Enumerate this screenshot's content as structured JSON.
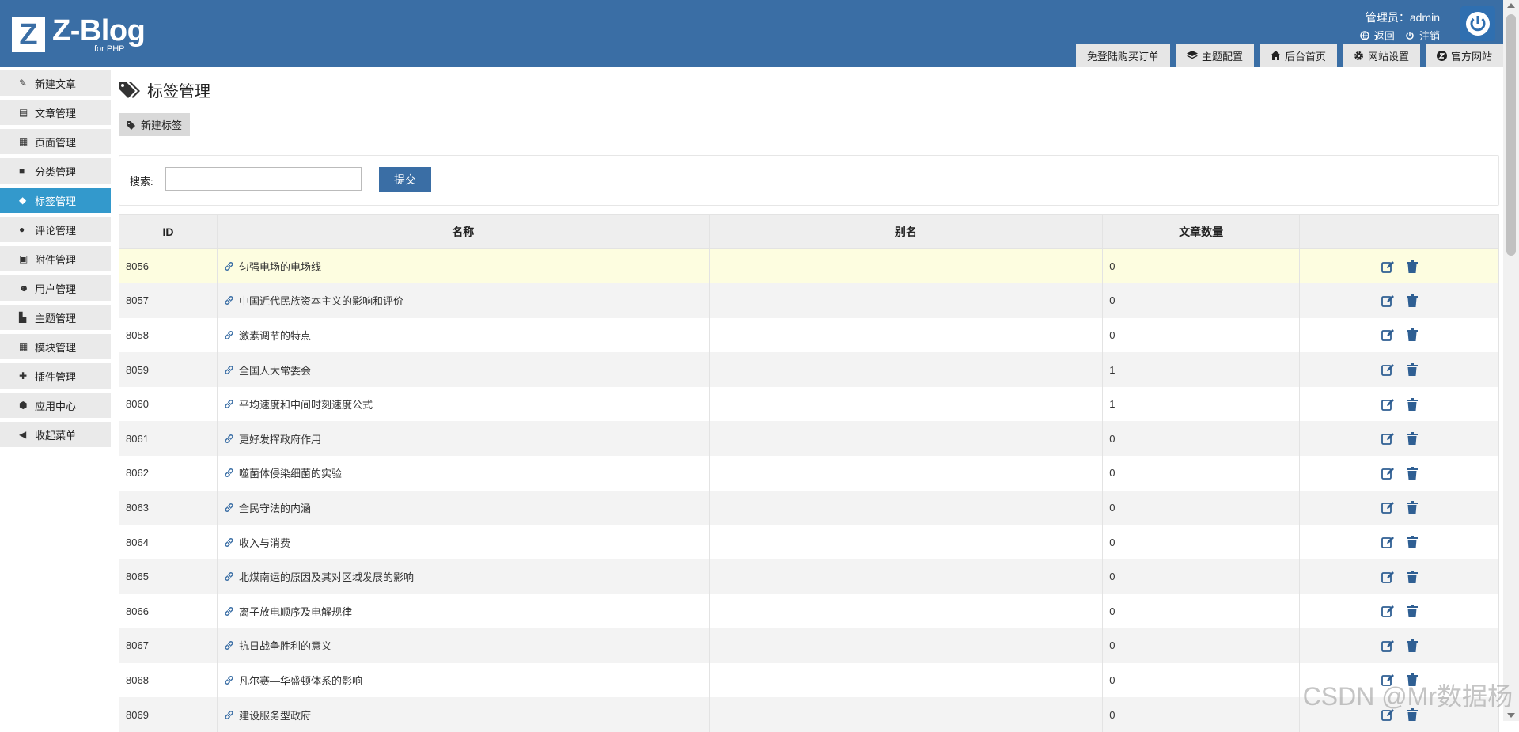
{
  "header": {
    "logo_main": "Z-Blog",
    "logo_sub": "for PHP",
    "user_label": "管理员：admin",
    "back_label": "返回",
    "logout_label": "注销",
    "tabs": [
      {
        "label": "免登陆购买订单",
        "icon": ""
      },
      {
        "label": "主题配置",
        "icon": "layers-icon"
      },
      {
        "label": "后台首页",
        "icon": "home-icon"
      },
      {
        "label": "网站设置",
        "icon": "gear-icon"
      },
      {
        "label": "官方网站",
        "icon": "zblog-icon"
      }
    ]
  },
  "sidebar": {
    "items": [
      {
        "label": "新建文章",
        "icon": "edit-icon"
      },
      {
        "label": "文章管理",
        "icon": "document-icon"
      },
      {
        "label": "页面管理",
        "icon": "page-icon"
      },
      {
        "label": "分类管理",
        "icon": "folder-icon"
      },
      {
        "label": "标签管理",
        "icon": "tag-icon",
        "active": true
      },
      {
        "label": "评论管理",
        "icon": "comment-icon"
      },
      {
        "label": "附件管理",
        "icon": "archive-icon"
      },
      {
        "label": "用户管理",
        "icon": "users-icon"
      },
      {
        "label": "主题管理",
        "icon": "layout-icon"
      },
      {
        "label": "模块管理",
        "icon": "grid-icon"
      },
      {
        "label": "插件管理",
        "icon": "puzzle-icon"
      },
      {
        "label": "应用中心",
        "icon": "box-icon"
      },
      {
        "label": "收起菜单",
        "icon": "caret-left-icon"
      }
    ]
  },
  "main": {
    "title": "标签管理",
    "new_tag_label": "新建标签",
    "search": {
      "label": "搜索:",
      "value": "",
      "submit_label": "提交"
    },
    "table": {
      "headers": [
        "ID",
        "名称",
        "别名",
        "文章数量",
        ""
      ],
      "rows": [
        {
          "id": "8056",
          "name": "匀强电场的电场线",
          "alias": "",
          "count": "0"
        },
        {
          "id": "8057",
          "name": "中国近代民族资本主义的影响和评价",
          "alias": "",
          "count": "0"
        },
        {
          "id": "8058",
          "name": "激素调节的特点",
          "alias": "",
          "count": "0"
        },
        {
          "id": "8059",
          "name": "全国人大常委会",
          "alias": "",
          "count": "1"
        },
        {
          "id": "8060",
          "name": "平均速度和中间时刻速度公式",
          "alias": "",
          "count": "1"
        },
        {
          "id": "8061",
          "name": "更好发挥政府作用",
          "alias": "",
          "count": "0"
        },
        {
          "id": "8062",
          "name": "噬菌体侵染细菌的实验",
          "alias": "",
          "count": "0"
        },
        {
          "id": "8063",
          "name": "全民守法的内涵",
          "alias": "",
          "count": "0"
        },
        {
          "id": "8064",
          "name": "收入与消费",
          "alias": "",
          "count": "0"
        },
        {
          "id": "8065",
          "name": "北煤南运的原因及其对区域发展的影响",
          "alias": "",
          "count": "0"
        },
        {
          "id": "8066",
          "name": "离子放电顺序及电解规律",
          "alias": "",
          "count": "0"
        },
        {
          "id": "8067",
          "name": "抗日战争胜利的意义",
          "alias": "",
          "count": "0"
        },
        {
          "id": "8068",
          "name": "凡尔赛—华盛顿体系的影响",
          "alias": "",
          "count": "0"
        },
        {
          "id": "8069",
          "name": "建设服务型政府",
          "alias": "",
          "count": "0"
        }
      ]
    }
  },
  "watermark": "CSDN @Mr数据杨",
  "colors": {
    "header": "#3a6ea5",
    "active": "#3399cc",
    "row_highlight": "#fdfde0"
  }
}
